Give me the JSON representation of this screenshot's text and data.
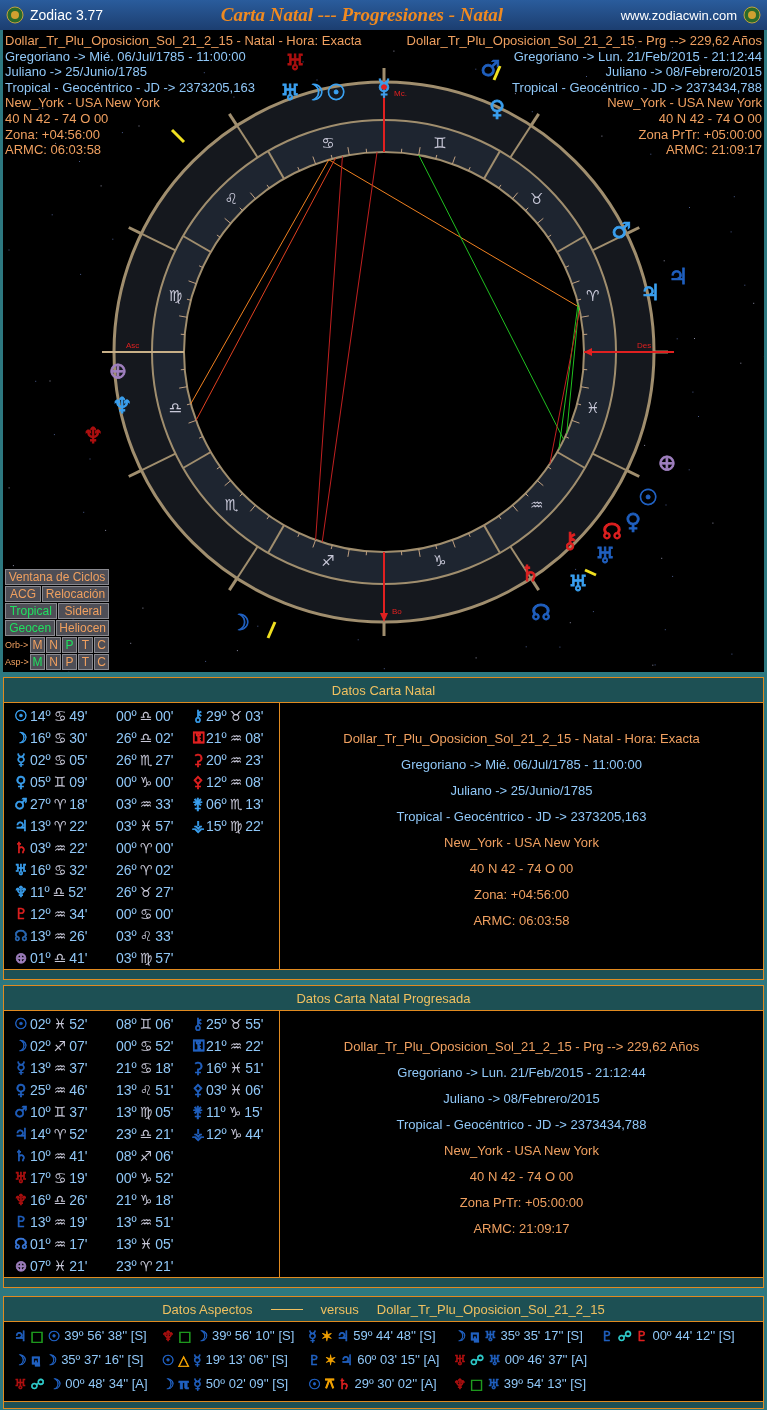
{
  "title_bar": {
    "app_name": "Zodiac 3.77",
    "title": "Carta Natal --- Progresiones - Natal",
    "website": "www.zodiacwin.com"
  },
  "chart": {
    "natal_info": [
      {
        "text": "Dollar_Tr_Plu_Oposicion_Sol_21_2_15 - Natal - Hora: Exacta",
        "color": "#f0a060"
      },
      {
        "text": "Gregoriano -> Mié. 06/Jul/1785 - 11:00:00",
        "color": "#90c8f8"
      },
      {
        "text": "Juliano -> 25/Junio/1785",
        "color": "#90c8f8"
      },
      {
        "text": "Tropical - Geocéntrico - JD -> 2373205,163",
        "color": "#90c8f8"
      },
      {
        "text": "New_York - USA New York",
        "color": "#f0a060"
      },
      {
        "text": "40 N 42 - 74 O 00",
        "color": "#f0a060"
      },
      {
        "text": "Zona: +04:56:00",
        "color": "#f0a060"
      },
      {
        "text": "ARMC: 06:03:58",
        "color": "#f0a060"
      }
    ],
    "progressed_info": [
      {
        "text": "Dollar_Tr_Plu_Oposicion_Sol_21_2_15 - Prg --> 229,62 Años",
        "color": "#f0a060"
      },
      {
        "text": "Gregoriano -> Lun. 21/Feb/2015 - 21:12:44",
        "color": "#90c8f8"
      },
      {
        "text": "Juliano -> 08/Febrero/2015",
        "color": "#90c8f8"
      },
      {
        "text": "Tropical - Geocéntrico - JD -> 2373434,788",
        "color": "#90c8f8"
      },
      {
        "text": "New_York - USA New York",
        "color": "#f0a060"
      },
      {
        "text": "40 N 42 - 74 O 00",
        "color": "#f0a060"
      },
      {
        "text": "Zona PrTr: +05:00:00",
        "color": "#f0a060"
      },
      {
        "text": "ARMC: 21:09:17",
        "color": "#f0a060"
      }
    ],
    "signs": [
      "♈",
      "♉",
      "♊",
      "♋",
      "♌",
      "♍",
      "♎",
      "♏",
      "♐",
      "♑",
      "♒",
      "♓"
    ],
    "axis_labels": {
      "mc": "Mc.",
      "asc": "Asc",
      "des": "Des.",
      "ic": "Bo"
    },
    "glyphs": [
      {
        "glyph": "♅",
        "color": "#b01010"
      },
      {
        "glyph": "♅",
        "color": "#3aa0f0"
      },
      {
        "glyph": "☽",
        "color": "#3aa0f0"
      },
      {
        "glyph": "☉",
        "color": "#3aa0f0"
      },
      {
        "glyph": "☿",
        "color": "#3aa0f0"
      },
      {
        "glyph": "♂",
        "color": "#2060c0"
      },
      {
        "glyph": "♀",
        "color": "#3aa0f0"
      },
      {
        "glyph": "♂",
        "color": "#3aa0f0"
      },
      {
        "glyph": "♃",
        "color": "#2060c0"
      },
      {
        "glyph": "♃",
        "color": "#3aa0f0"
      },
      {
        "glyph": "⊕",
        "color": "#a080c0"
      },
      {
        "glyph": "♆",
        "color": "#3aa0f0"
      },
      {
        "glyph": "♆",
        "color": "#b01010"
      },
      {
        "glyph": "⊕",
        "color": "#a080c0"
      },
      {
        "glyph": "☉",
        "color": "#2060c0"
      },
      {
        "glyph": "♀",
        "color": "#2060c0"
      },
      {
        "glyph": "☊",
        "color": "#e02020"
      },
      {
        "glyph": "⚷",
        "color": "#e02020"
      },
      {
        "glyph": "♅",
        "color": "#2060c0"
      },
      {
        "glyph": "♄",
        "color": "#e02020"
      },
      {
        "glyph": "♅",
        "color": "#3aa0f0"
      },
      {
        "glyph": "☊",
        "color": "#2060c0"
      },
      {
        "glyph": "☽",
        "color": "#2060c0"
      }
    ],
    "controls": {
      "cycles": "Ventana de Ciclos",
      "acg": "ACG",
      "relocation": "Relocación",
      "zodiac": [
        {
          "label": "Tropical",
          "selected": true
        },
        {
          "label": "Sideral",
          "selected": false
        }
      ],
      "center": [
        {
          "label": "Geocen",
          "selected": true
        },
        {
          "label": "Heliocen",
          "selected": false
        }
      ],
      "orb": {
        "label": "Orb->",
        "options": [
          {
            "label": "M",
            "selected": false
          },
          {
            "label": "N",
            "selected": false
          },
          {
            "label": "P",
            "selected": true
          },
          {
            "label": "T",
            "selected": false
          },
          {
            "label": "C",
            "selected": false
          }
        ]
      },
      "asp": {
        "label": "Asp->",
        "options": [
          {
            "label": "M",
            "selected": true
          },
          {
            "label": "N",
            "selected": false
          },
          {
            "label": "P",
            "selected": false
          },
          {
            "label": "T",
            "selected": false
          },
          {
            "label": "C",
            "selected": false
          }
        ]
      }
    }
  },
  "natal_panel": {
    "title": "Datos Carta Natal",
    "planets": [
      {
        "glyph": "☉",
        "color": "#3aa0f0",
        "deg": "14º",
        "sign": "♋",
        "min": "49'"
      },
      {
        "glyph": "☽",
        "color": "#3aa0f0",
        "deg": "16º",
        "sign": "♋",
        "min": "30'"
      },
      {
        "glyph": "☿",
        "color": "#3aa0f0",
        "deg": "02º",
        "sign": "♋",
        "min": "05'"
      },
      {
        "glyph": "♀",
        "color": "#3aa0f0",
        "deg": "05º",
        "sign": "♊",
        "min": "09'"
      },
      {
        "glyph": "♂",
        "color": "#3aa0f0",
        "deg": "27º",
        "sign": "♈",
        "min": "18'"
      },
      {
        "glyph": "♃",
        "color": "#3aa0f0",
        "deg": "13º",
        "sign": "♈",
        "min": "22'"
      },
      {
        "glyph": "♄",
        "color": "#e02020",
        "deg": "03º",
        "sign": "♒",
        "min": "22'"
      },
      {
        "glyph": "♅",
        "color": "#3aa0f0",
        "deg": "16º",
        "sign": "♋",
        "min": "32'"
      },
      {
        "glyph": "♆",
        "color": "#3aa0f0",
        "deg": "11º",
        "sign": "♎",
        "min": "52'"
      },
      {
        "glyph": "♇",
        "color": "#e02020",
        "deg": "12º",
        "sign": "♒",
        "min": "34'"
      },
      {
        "glyph": "☊",
        "color": "#2a6ab8",
        "deg": "13º",
        "sign": "♒",
        "min": "26'"
      },
      {
        "glyph": "⊕",
        "color": "#a080c0",
        "deg": "01º",
        "sign": "♎",
        "min": "41'"
      }
    ],
    "houses": [
      {
        "deg": "00º",
        "sign": "♎",
        "min": "00'"
      },
      {
        "deg": "26º",
        "sign": "♎",
        "min": "02'"
      },
      {
        "deg": "26º",
        "sign": "♏",
        "min": "27'"
      },
      {
        "deg": "00º",
        "sign": "♑",
        "min": "00'"
      },
      {
        "deg": "03º",
        "sign": "♒",
        "min": "33'"
      },
      {
        "deg": "03º",
        "sign": "♓",
        "min": "57'"
      },
      {
        "deg": "00º",
        "sign": "♈",
        "min": "00'"
      },
      {
        "deg": "26º",
        "sign": "♈",
        "min": "02'"
      },
      {
        "deg": "26º",
        "sign": "♉",
        "min": "27'"
      },
      {
        "deg": "00º",
        "sign": "♋",
        "min": "00'"
      },
      {
        "deg": "03º",
        "sign": "♌",
        "min": "33'"
      },
      {
        "deg": "03º",
        "sign": "♍",
        "min": "57'"
      }
    ],
    "asteroids": [
      {
        "glyph": "⚷",
        "color": "#3aa0f0",
        "deg": "29º",
        "sign": "♉",
        "min": "03'"
      },
      {
        "glyph": "⚿",
        "color": "#e02020",
        "deg": "21º",
        "sign": "♒",
        "min": "08'"
      },
      {
        "glyph": "⚳",
        "color": "#e02020",
        "deg": "20º",
        "sign": "♒",
        "min": "23'"
      },
      {
        "glyph": "⚴",
        "color": "#e02020",
        "deg": "12º",
        "sign": "♒",
        "min": "08'"
      },
      {
        "glyph": "⚵",
        "color": "#3aa0f0",
        "deg": "06º",
        "sign": "♏",
        "min": "13'"
      },
      {
        "glyph": "⚶",
        "color": "#3aa0f0",
        "deg": "15º",
        "sign": "♍",
        "min": "22'"
      }
    ],
    "info": [
      {
        "text": "Dollar_Tr_Plu_Oposicion_Sol_21_2_15 - Natal - Hora: Exacta",
        "color": "#f0a060"
      },
      {
        "text": "Gregoriano -> Mié. 06/Jul/1785 - 11:00:00",
        "color": "#90c8f8"
      },
      {
        "text": "Juliano -> 25/Junio/1785",
        "color": "#90c8f8"
      },
      {
        "text": "Tropical - Geocéntrico - JD -> 2373205,163",
        "color": "#90c8f8"
      },
      {
        "text": "New_York - USA New York",
        "color": "#f0a060"
      },
      {
        "text": "40 N 42 - 74 O 00",
        "color": "#f0a060"
      },
      {
        "text": "Zona: +04:56:00",
        "color": "#f0a060"
      },
      {
        "text": "ARMC: 06:03:58",
        "color": "#f0a060"
      }
    ]
  },
  "progressed_panel": {
    "title": "Datos Carta Natal Progresada",
    "planets": [
      {
        "glyph": "☉",
        "color": "#2060c0",
        "deg": "02º",
        "sign": "♓",
        "min": "52'"
      },
      {
        "glyph": "☽",
        "color": "#2060c0",
        "deg": "02º",
        "sign": "♐",
        "min": "07'"
      },
      {
        "glyph": "☿",
        "color": "#2060c0",
        "deg": "13º",
        "sign": "♒",
        "min": "37'"
      },
      {
        "glyph": "♀",
        "color": "#2060c0",
        "deg": "25º",
        "sign": "♒",
        "min": "46'"
      },
      {
        "glyph": "♂",
        "color": "#2060c0",
        "deg": "10º",
        "sign": "♊",
        "min": "37'"
      },
      {
        "glyph": "♃",
        "color": "#2060c0",
        "deg": "14º",
        "sign": "♈",
        "min": "52'"
      },
      {
        "glyph": "♄",
        "color": "#2060c0",
        "deg": "10º",
        "sign": "♒",
        "min": "41'"
      },
      {
        "glyph": "♅",
        "color": "#b01010",
        "deg": "17º",
        "sign": "♋",
        "min": "19'"
      },
      {
        "glyph": "♆",
        "color": "#b01010",
        "deg": "16º",
        "sign": "♎",
        "min": "26'"
      },
      {
        "glyph": "♇",
        "color": "#2060c0",
        "deg": "13º",
        "sign": "♒",
        "min": "19'"
      },
      {
        "glyph": "☊",
        "color": "#3a7ae0",
        "deg": "01º",
        "sign": "♒",
        "min": "17'"
      },
      {
        "glyph": "⊕",
        "color": "#a080c0",
        "deg": "07º",
        "sign": "♓",
        "min": "21'"
      }
    ],
    "houses": [
      {
        "deg": "08º",
        "sign": "♊",
        "min": "06'"
      },
      {
        "deg": "00º",
        "sign": "♋",
        "min": "52'"
      },
      {
        "deg": "21º",
        "sign": "♋",
        "min": "18'"
      },
      {
        "deg": "13º",
        "sign": "♌",
        "min": "51'"
      },
      {
        "deg": "13º",
        "sign": "♍",
        "min": "05'"
      },
      {
        "deg": "23º",
        "sign": "♎",
        "min": "21'"
      },
      {
        "deg": "08º",
        "sign": "♐",
        "min": "06'"
      },
      {
        "deg": "00º",
        "sign": "♑",
        "min": "52'"
      },
      {
        "deg": "21º",
        "sign": "♑",
        "min": "18'"
      },
      {
        "deg": "13º",
        "sign": "♒",
        "min": "51'"
      },
      {
        "deg": "13º",
        "sign": "♓",
        "min": "05'"
      },
      {
        "deg": "23º",
        "sign": "♈",
        "min": "21'"
      }
    ],
    "asteroids": [
      {
        "glyph": "⚷",
        "color": "#2060c0",
        "deg": "25º",
        "sign": "♉",
        "min": "55'"
      },
      {
        "glyph": "⚿",
        "color": "#2060c0",
        "deg": "21º",
        "sign": "♒",
        "min": "22'"
      },
      {
        "glyph": "⚳",
        "color": "#2060c0",
        "deg": "16º",
        "sign": "♓",
        "min": "51'"
      },
      {
        "glyph": "⚴",
        "color": "#2060c0",
        "deg": "03º",
        "sign": "♓",
        "min": "06'"
      },
      {
        "glyph": "⚵",
        "color": "#2060c0",
        "deg": "11º",
        "sign": "♑",
        "min": "15'"
      },
      {
        "glyph": "⚶",
        "color": "#2060c0",
        "deg": "12º",
        "sign": "♑",
        "min": "44'"
      }
    ],
    "info": [
      {
        "text": "Dollar_Tr_Plu_Oposicion_Sol_21_2_15 - Prg --> 229,62 Años",
        "color": "#f0a060"
      },
      {
        "text": "Gregoriano -> Lun. 21/Feb/2015 - 21:12:44",
        "color": "#90c8f8"
      },
      {
        "text": "Juliano -> 08/Febrero/2015",
        "color": "#90c8f8"
      },
      {
        "text": "Tropical - Geocéntrico - JD -> 2373434,788",
        "color": "#90c8f8"
      },
      {
        "text": "New_York - USA New York",
        "color": "#f0a060"
      },
      {
        "text": "40 N 42 - 74 O 00",
        "color": "#f0a060"
      },
      {
        "text": "Zona PrTr: +05:00:00",
        "color": "#f0a060"
      },
      {
        "text": "ARMC: 21:09:17",
        "color": "#f0a060"
      }
    ]
  },
  "aspects_panel": {
    "title": "Datos Aspectos",
    "versus": "versus",
    "chart_name": "Dollar_Tr_Plu_Oposicion_Sol_21_2_15",
    "columns": [
      [
        {
          "glyphs": [
            {
              "g": "♃",
              "color": "#2060c0"
            },
            {
              "g": "□",
              "color": "#20a020"
            },
            {
              "g": "☉",
              "color": "#2060c0"
            }
          ],
          "value": "39º 56' 38'' [S]"
        },
        {
          "glyphs": [
            {
              "g": "☽",
              "color": "#2060c0"
            },
            {
              "g": "⚼",
              "color": "#2060c0"
            },
            {
              "g": "☽",
              "color": "#2060c0"
            }
          ],
          "value": "35º 37' 16'' [S]"
        },
        {
          "glyphs": [
            {
              "g": "♅",
              "color": "#b01010"
            },
            {
              "g": "☍",
              "color": "#30d0d0"
            },
            {
              "g": "☽",
              "color": "#2060c0"
            }
          ],
          "value": "00º 48' 34'' [A]"
        }
      ],
      [
        {
          "glyphs": [
            {
              "g": "♆",
              "color": "#b01010"
            },
            {
              "g": "□",
              "color": "#20a020"
            },
            {
              "g": "☽",
              "color": "#2060c0"
            }
          ],
          "value": "39º 56' 10'' [S]"
        },
        {
          "glyphs": [
            {
              "g": "☉",
              "color": "#2060c0"
            },
            {
              "g": "△",
              "color": "#f0a000"
            },
            {
              "g": "☿",
              "color": "#2060c0"
            }
          ],
          "value": "19º 13' 06'' [S]"
        },
        {
          "glyphs": [
            {
              "g": "☽",
              "color": "#2060c0"
            },
            {
              "g": "π",
              "color": "#2060c0"
            },
            {
              "g": "☿",
              "color": "#2060c0"
            }
          ],
          "value": "50º 02' 09'' [S]"
        }
      ],
      [
        {
          "glyphs": [
            {
              "g": "☿",
              "color": "#2060c0"
            },
            {
              "g": "✶",
              "color": "#f0a000"
            },
            {
              "g": "♃",
              "color": "#2060c0"
            }
          ],
          "value": "59º 44' 48'' [S]"
        },
        {
          "glyphs": [
            {
              "g": "♇",
              "color": "#2060c0"
            },
            {
              "g": "✶",
              "color": "#f0a000"
            },
            {
              "g": "♃",
              "color": "#2060c0"
            }
          ],
          "value": "60º 03' 15'' [A]"
        },
        {
          "glyphs": [
            {
              "g": "☉",
              "color": "#2060c0"
            },
            {
              "g": "⚻",
              "color": "#f0a000"
            },
            {
              "g": "♄",
              "color": "#e02020"
            }
          ],
          "value": "29º 30' 02'' [A]"
        }
      ],
      [
        {
          "glyphs": [
            {
              "g": "☽",
              "color": "#2060c0"
            },
            {
              "g": "⚼",
              "color": "#2060c0"
            },
            {
              "g": "♅",
              "color": "#2060c0"
            }
          ],
          "value": "35º 35' 17'' [S]"
        },
        {
          "glyphs": [
            {
              "g": "♅",
              "color": "#b01010"
            },
            {
              "g": "☍",
              "color": "#30d0d0"
            },
            {
              "g": "♅",
              "color": "#2060c0"
            }
          ],
          "value": "00º 46' 37'' [A]"
        },
        {
          "glyphs": [
            {
              "g": "♆",
              "color": "#b01010"
            },
            {
              "g": "□",
              "color": "#20a020"
            },
            {
              "g": "♅",
              "color": "#2060c0"
            }
          ],
          "value": "39º 54' 13'' [S]"
        }
      ],
      [
        {
          "glyphs": [
            {
              "g": "♇",
              "color": "#2060c0"
            },
            {
              "g": "☍",
              "color": "#30d0d0"
            },
            {
              "g": "♇",
              "color": "#e02020"
            }
          ],
          "value": "00º 44' 12'' [S]"
        }
      ]
    ]
  }
}
